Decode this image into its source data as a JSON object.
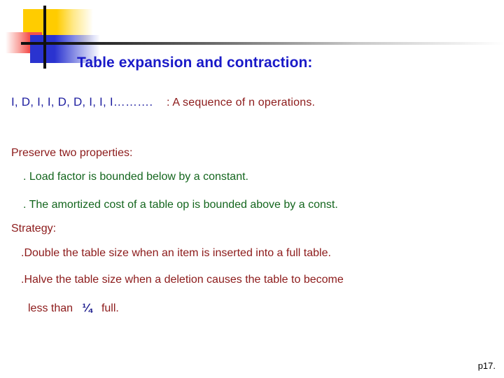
{
  "slide": {
    "title": "Table expansion and contraction:",
    "page_label": "p17."
  },
  "decoration": {
    "yellow_square": "yellow-square",
    "red_square": "red-square",
    "blue_square": "blue-square",
    "vertical_rule": "vertical-rule",
    "horizontal_rule": "horizontal-rule",
    "colors": {
      "yellow": "#FFCC00",
      "red": "#F4504E",
      "blue": "#2A33D0",
      "rule": "#101010",
      "title": "#1A1AC8"
    }
  },
  "body": {
    "sequence": "I,  D,  I,  I,  D,  D,  I,  I,  I……….",
    "sequence_desc": ": A sequence of n operations.",
    "preserve_heading": "Preserve two properties:",
    "property_1": ". Load factor is bounded below by a constant.",
    "property_2": ". The amortized cost of a table op is bounded above by a const.",
    "strategy_heading": "Strategy:",
    "strategy_1": ".Double the table size when an item is inserted into a full table.",
    "strategy_2": ".Halve the table size when a deletion causes the table to become",
    "strategy_2_prefix": "less than",
    "strategy_2_fraction": "¼",
    "strategy_2_suffix": "full."
  }
}
